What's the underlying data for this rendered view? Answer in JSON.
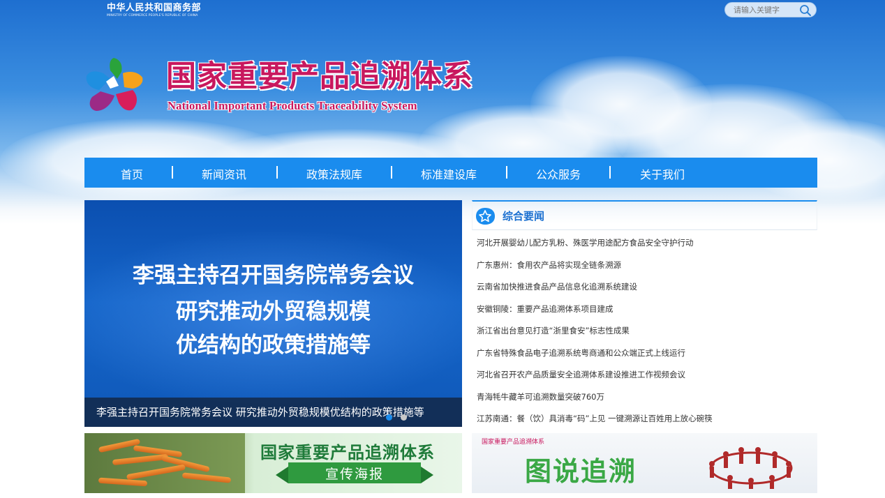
{
  "header": {
    "ministry_cn": "中华人民共和国商务部",
    "ministry_en": "MINISTRY OF COMMERCE PEOPLE'S REPUBLIC OF CHINA",
    "search_placeholder": "请输入关键字",
    "site_title_cn": "国家重要产品追溯体系",
    "site_title_en": "National Important Products Traceability System"
  },
  "nav": {
    "items": [
      "首页",
      "新闻资讯",
      "政策法规库",
      "标准建设库",
      "公众服务",
      "关于我们"
    ],
    "separator": "|"
  },
  "slider": {
    "lines": [
      "李强主持召开国务院常务会议",
      "研究推动外贸稳规模",
      "优结构的政策措施等"
    ],
    "caption": "李强主持召开国务院常务会议 研究推动外贸稳规模优结构的政策措施等",
    "dot_count": 2,
    "active_dot": 0,
    "colors": {
      "active_dot": "#1a8cee",
      "inactive_dot": "#c8c8c8"
    }
  },
  "news": {
    "title": "综合要闻",
    "items": [
      "河北开展婴幼儿配方乳粉、殊医学用途配方食品安全守护行动",
      "广东惠州：食用农产品将实现全链条溯源",
      "云南省加快推进食品产品信息化追溯系统建设",
      "安徽铜陵：重要产品追溯体系项目建成",
      "浙江省出台意见打造“浙里食安”标志性成果",
      "广东省特殊食品电子追溯系统粤商通和公众端正式上线运行",
      "河北省召开农产品质量安全追溯体系建设推进工作视频会议",
      "青海牦牛藏羊可追溯数量突破760万",
      "江苏南通：餐（饮）具消毒“码”上见 一键溯源让百姓用上放心碗筷"
    ]
  },
  "banners": {
    "left": {
      "title": "国家重要产品追溯体系",
      "subtitle": "宣传海报"
    },
    "right": {
      "small_label": "国家重要产品追溯体系",
      "title": "图说追溯"
    }
  },
  "colors": {
    "nav_bg": "#1a8cee",
    "title_magenta": "#c8185e",
    "news_title": "#1a6fd0"
  }
}
